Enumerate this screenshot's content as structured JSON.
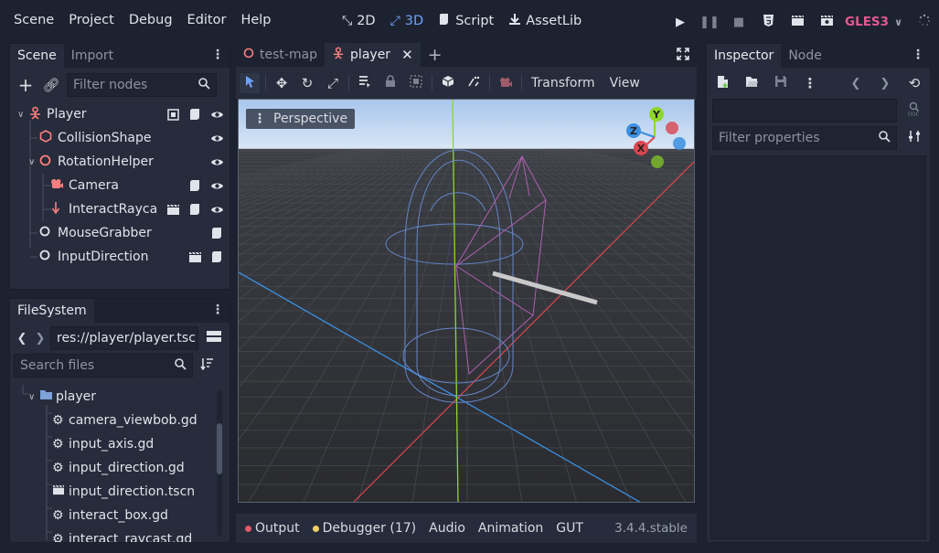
{
  "menu": [
    "Scene",
    "Project",
    "Debug",
    "Editor",
    "Help"
  ],
  "workspaces": [
    {
      "label": "2D",
      "icon": "2d-icon"
    },
    {
      "label": "3D",
      "icon": "3d-icon"
    },
    {
      "label": "Script",
      "icon": "script-icon"
    },
    {
      "label": "AssetLib",
      "icon": "assetlib-icon"
    }
  ],
  "renderer": "GLES3",
  "scene_dock": {
    "tabs": [
      "Scene",
      "Import"
    ],
    "filter_placeholder": "Filter nodes",
    "nodes": [
      {
        "label": "Player",
        "icon": "kinematic-body-icon"
      },
      {
        "label": "CollisionShape",
        "icon": "collision-shape-icon"
      },
      {
        "label": "RotationHelper",
        "icon": "spatial-icon"
      },
      {
        "label": "Camera",
        "icon": "camera-icon"
      },
      {
        "label": "InteractRayca",
        "icon": "raycast-icon"
      },
      {
        "label": "MouseGrabber",
        "icon": "node-icon"
      },
      {
        "label": "InputDirection",
        "icon": "node-icon"
      }
    ]
  },
  "filesystem": {
    "title": "FileSystem",
    "path": "res://player/player.tsc",
    "search_placeholder": "Search files",
    "folder": "player",
    "files": [
      "camera_viewbob.gd",
      "input_axis.gd",
      "input_direction.gd",
      "input_direction.tscn",
      "interact_box.gd",
      "interact_raycast.gd"
    ]
  },
  "editor_tabs": [
    "test-map",
    "player"
  ],
  "viewport_toolbar": {
    "transform": "Transform",
    "view": "View"
  },
  "viewport": {
    "label": "Perspective"
  },
  "gizmo": {
    "y": "Y",
    "z": "Z",
    "x": "X"
  },
  "bottom": {
    "output": "Output",
    "debugger": "Debugger (17)",
    "audio": "Audio",
    "animation": "Animation",
    "gut": "GUT",
    "version": "3.4.4.stable"
  },
  "inspector": {
    "tabs": [
      "Inspector",
      "Node"
    ],
    "filter_placeholder": "Filter properties"
  },
  "colors": {
    "accent": "#6ea4ff",
    "renderer": "#e05a90",
    "output_dot": "#e05a6a",
    "debugger_dot": "#f2d068"
  }
}
